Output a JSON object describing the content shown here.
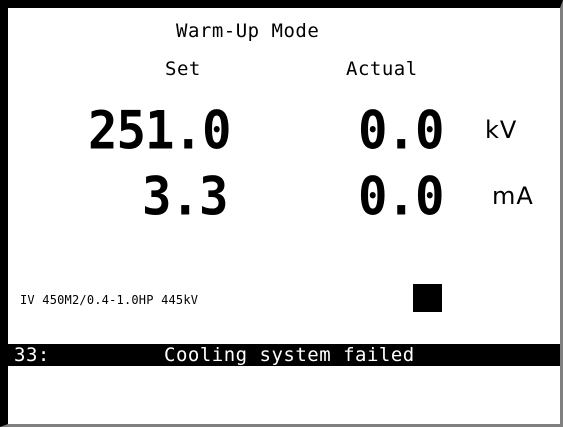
{
  "display": {
    "mode_title": "Warm-Up Mode",
    "columns": {
      "set": "Set",
      "actual": "Actual"
    },
    "voltage": {
      "set": "251.0",
      "actual": "0.0",
      "unit": "kV"
    },
    "current": {
      "set": "3.3",
      "actual": "0.0",
      "unit": "mA"
    },
    "tube_model": "IV 450M2/0.4-1.0HP 445kV",
    "status": {
      "code": "33:",
      "message": "Cooling system failed"
    }
  },
  "colors": {
    "background": "#ffffff",
    "foreground": "#000000",
    "status_bar": "#000000",
    "status_text": "#ffffff"
  },
  "icons": {
    "indicator": "square-indicator-icon"
  }
}
